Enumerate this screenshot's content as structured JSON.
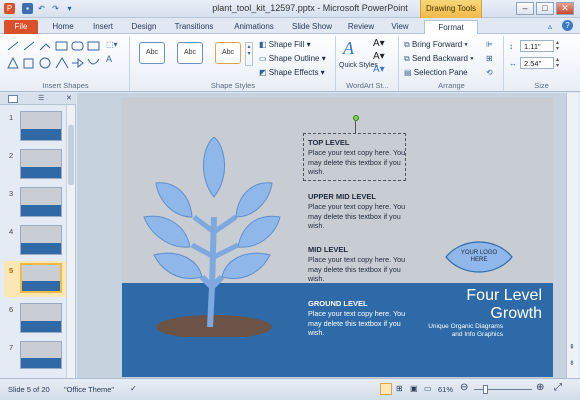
{
  "window": {
    "title": "plant_tool_kit_12597.pptx - Microsoft PowerPoint",
    "contextual_tab": "Drawing Tools"
  },
  "tabs": [
    {
      "label": "File"
    },
    {
      "label": "Home"
    },
    {
      "label": "Insert"
    },
    {
      "label": "Design"
    },
    {
      "label": "Transitions"
    },
    {
      "label": "Animations"
    },
    {
      "label": "Slide Show"
    },
    {
      "label": "Review"
    },
    {
      "label": "View"
    },
    {
      "label": "Format"
    }
  ],
  "ribbon": {
    "insert_shapes": {
      "label": "Insert Shapes"
    },
    "shape_styles": {
      "label": "Shape Styles",
      "presets": [
        "Abc",
        "Abc",
        "Abc"
      ],
      "shape_fill": "Shape Fill",
      "shape_outline": "Shape Outline",
      "shape_effects": "Shape Effects"
    },
    "wordart": {
      "label": "WordArt St...",
      "quick_styles": "Quick Styles"
    },
    "arrange": {
      "label": "Arrange",
      "bring_forward": "Bring Forward",
      "send_backward": "Send Backward",
      "selection_pane": "Selection Pane"
    },
    "size": {
      "label": "Size",
      "height": "1.11\"",
      "width": "2.54\""
    }
  },
  "slides": [
    {
      "num": "1"
    },
    {
      "num": "2"
    },
    {
      "num": "3"
    },
    {
      "num": "4"
    },
    {
      "num": "5"
    },
    {
      "num": "6"
    },
    {
      "num": "7"
    }
  ],
  "slide": {
    "levels": [
      {
        "title": "TOP LEVEL",
        "body": "Place your text copy here. You may delete this textbox if you wish."
      },
      {
        "title": "UPPER MID LEVEL",
        "body": "Place your text copy here. You may delete this textbox if you wish."
      },
      {
        "title": "MID LEVEL",
        "body": "Place your text copy here. You may delete this textbox if you wish."
      },
      {
        "title": "GROUND LEVEL",
        "body": "Place your text copy here. You may delete this textbox if you wish."
      }
    ],
    "logo_text": "YOUR LOGO HERE",
    "headline_1": "Four Level",
    "headline_2": "Growth",
    "subhead": "Unique Organic Diagrams and Info Graphics"
  },
  "status": {
    "slide_of": "Slide 5 of 20",
    "theme": "\"Office Theme\"",
    "zoom": "61%"
  },
  "colors": {
    "file_tab": "#d9502a",
    "drawing_tools": "#f0b94a",
    "slide_band": "#2d6aa7",
    "leaf": "#8fb7ea"
  }
}
